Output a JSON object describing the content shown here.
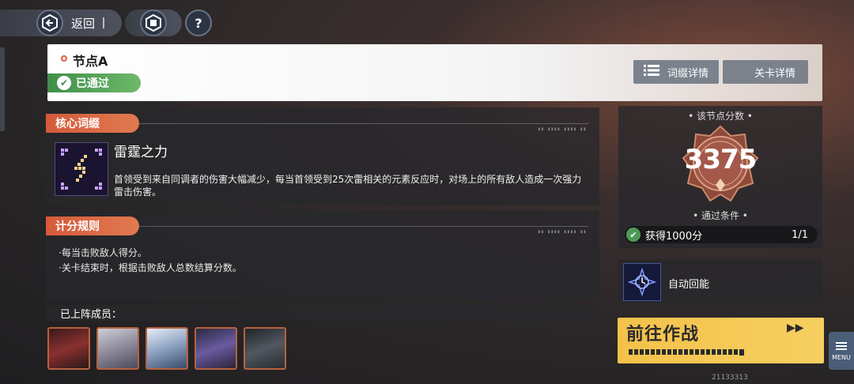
{
  "topbar": {
    "back_label": "返回",
    "help_label": "?"
  },
  "header": {
    "node_title": "节点A",
    "status": "已通过",
    "affix_button": "词缀详情",
    "stage_button": "关卡详情"
  },
  "core_affix": {
    "tab_label": "核心词缀",
    "name": "雷霆之力",
    "description": "首领受到来自同调者的伤害大幅减少，每当首领受到25次雷相关的元素反应时，对场上的所有敌人造成一次强力雷击伤害。",
    "icon": "lightning-icon"
  },
  "scoring": {
    "tab_label": "计分规则",
    "rules": [
      "·每当击败敌人得分。",
      "·关卡结束时，根据击败敌人总数结算分数。"
    ]
  },
  "members": {
    "label": "已上阵成员：",
    "count": 5
  },
  "score": {
    "title": "• 该节点分数 •",
    "value": "3375",
    "condition_title": "• 通过条件 •",
    "condition_text": "获得1000分",
    "condition_progress": "1/1"
  },
  "auto": {
    "label": "自动回能"
  },
  "go": {
    "label": "前往作战",
    "arrows": "▶▶"
  },
  "menu": {
    "label": "MENU"
  },
  "uid": "21133313",
  "colors": {
    "accent_orange": "#d55a3a",
    "pass_green": "#4e9a55",
    "go_yellow": "#f3c24a"
  }
}
